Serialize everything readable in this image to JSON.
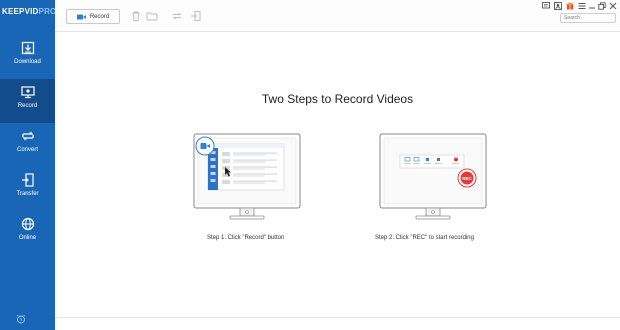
{
  "app": {
    "logo_main": "KEEPVID",
    "logo_accent": "PRO"
  },
  "sidebar": {
    "items": [
      {
        "label": "Download",
        "icon": "download-icon"
      },
      {
        "label": "Record",
        "icon": "record-icon",
        "active": true
      },
      {
        "label": "Convert",
        "icon": "convert-icon"
      },
      {
        "label": "Transfer",
        "icon": "transfer-icon"
      },
      {
        "label": "Online",
        "icon": "online-icon"
      }
    ]
  },
  "toolbar": {
    "record_label": "Record",
    "search_placeholder": "Search"
  },
  "main": {
    "title": "Two Steps to Record Videos",
    "step1_caption": "Step 1: Click \"Record\" button",
    "step2_caption": "Step 2: Click \"REC\" to start recording",
    "rec_badge": "REC"
  },
  "colors": {
    "sidebar_bg": "#1966b6",
    "sidebar_active": "#124c8c",
    "accent_blue": "#2d7fd8",
    "rec_red": "#e23b3b"
  }
}
